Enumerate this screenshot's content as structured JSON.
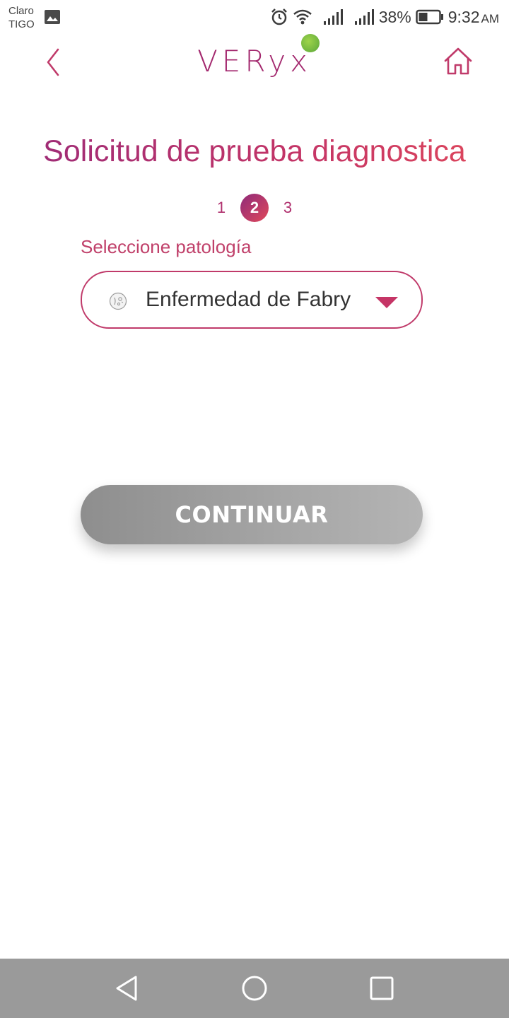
{
  "status_bar": {
    "carrier_line1": "Claro",
    "carrier_line2": "TIGO",
    "battery_percent": "38%",
    "time": "9:32",
    "ampm": "AM",
    "icons": [
      "gallery-icon",
      "alarm-icon",
      "wifi-icon",
      "signal-icon",
      "signal-icon",
      "battery-icon"
    ]
  },
  "header": {
    "logo_text": "VERyx",
    "back_icon": "chevron-left-icon",
    "home_icon": "home-icon"
  },
  "page": {
    "title": "Solicitud de prueba diagnostica"
  },
  "stepper": {
    "steps": [
      "1",
      "2",
      "3"
    ],
    "active_step": "2"
  },
  "form": {
    "pathology_label": "Seleccione patología",
    "pathology_value": "Enfermedad de Fabry",
    "continue_label": "CONTINUAR"
  },
  "colors": {
    "brand_primary": "#a3286e",
    "brand_accent": "#e0485a",
    "button_disabled": "#a6a6a6",
    "navbar_bg": "#9a9a9a"
  },
  "nav_bar": {
    "icons": [
      "nav-back-icon",
      "nav-home-icon",
      "nav-recent-icon"
    ]
  }
}
